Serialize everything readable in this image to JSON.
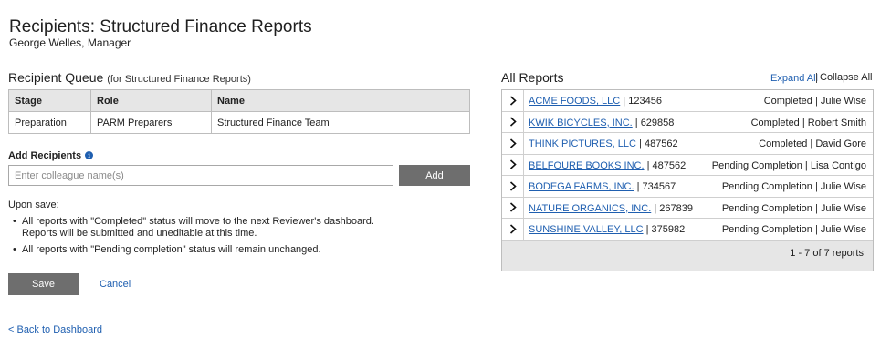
{
  "header": {
    "title": "Recipients: Structured Finance Reports",
    "subtitle": "George Welles, Manager"
  },
  "queue": {
    "heading": "Recipient Queue",
    "heading_sub": "(for Structured Finance Reports)",
    "columns": [
      "Stage",
      "Role",
      "Name"
    ],
    "rows": [
      [
        "Preparation",
        "PARM Preparers",
        "Structured Finance Team"
      ]
    ]
  },
  "add_recipients": {
    "label": "Add Recipients",
    "placeholder": "Enter colleague name(s)",
    "button_label": "Add",
    "info_icon_glyph": "i"
  },
  "upon_save": {
    "heading": "Upon save:",
    "bullet_1_line_1": "All reports with \"Completed\" status will move to the next Reviewer's dashboard.",
    "bullet_1_line_2": "Reports will be submitted and uneditable at this time.",
    "bullet_2": "All reports with \"Pending completion\" status will remain unchanged."
  },
  "actions": {
    "save_label": "Save",
    "cancel_label": "Cancel",
    "back_label": "< Back to Dashboard"
  },
  "reports": {
    "heading": "All Reports",
    "expand_all": "Expand All",
    "collapse_all": "Collapse All",
    "items": [
      {
        "company": "ACME FOODS, LLC",
        "id": "123456",
        "status": "Completed",
        "owner": "Julie Wise"
      },
      {
        "company": "KWIK BICYCLES, INC.",
        "id": "629858",
        "status": "Completed",
        "owner": "Robert Smith"
      },
      {
        "company": "THINK PICTURES, LLC",
        "id": "487562",
        "status": "Completed",
        "owner": "David Gore"
      },
      {
        "company": "BELFOURE BOOKS INC.",
        "id": "487562",
        "status": "Pending Completion",
        "owner": "Lisa Contigo"
      },
      {
        "company": "BODEGA FARMS, INC.",
        "id": "734567",
        "status": "Pending Completion",
        "owner": "Julie Wise"
      },
      {
        "company": "NATURE ORGANICS, INC.",
        "id": "267839",
        "status": "Pending Completion",
        "owner": "Julie Wise"
      },
      {
        "company": "SUNSHINE VALLEY, LLC",
        "id": "375982",
        "status": "Pending Completion",
        "owner": "Julie Wise"
      }
    ],
    "pagination": "1 - 7 of 7 reports"
  },
  "icons": {
    "row_expand": "chevron-right-icon",
    "info": "info-icon"
  },
  "colors": {
    "link": "#1f5fb0",
    "button_bg": "#6e6e6e",
    "table_header_bg": "#e6e6e6"
  }
}
